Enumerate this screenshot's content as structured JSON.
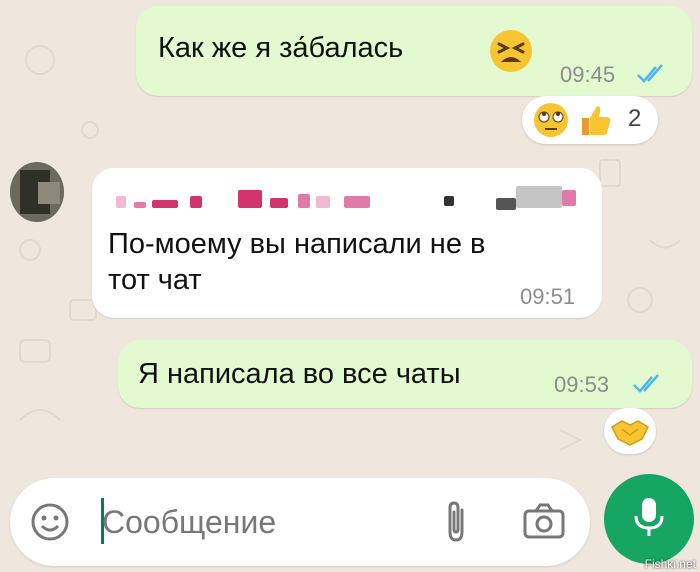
{
  "messages": [
    {
      "text": "Как же я за́балась",
      "time": "09:45",
      "direction": "outgoing",
      "read": true,
      "emoji": "tired-face"
    },
    {
      "text": "По-моему вы написали не в\nтот чат",
      "time": "09:51",
      "direction": "incoming",
      "sender_name_blurred": true
    },
    {
      "text": "Я написала во все чаты",
      "time": "09:53",
      "direction": "outgoing",
      "read": true
    }
  ],
  "reactions": [
    {
      "emojis": [
        "face-with-rolling-eyes",
        "thumbs-up"
      ],
      "count": "2"
    },
    {
      "emojis": [
        "handshake"
      ]
    }
  ],
  "composer": {
    "placeholder": "Сообщение",
    "icons": [
      "smiley-icon",
      "paperclip-icon",
      "camera-icon",
      "microphone-icon"
    ]
  },
  "watermark": "Fishki.net",
  "colors": {
    "outgoing_bubble": "#e3f9cf",
    "incoming_bubble": "#ffffff",
    "read_ticks": "#4fb6ec",
    "mic_button": "#17a563",
    "background": "#efe7dd"
  }
}
